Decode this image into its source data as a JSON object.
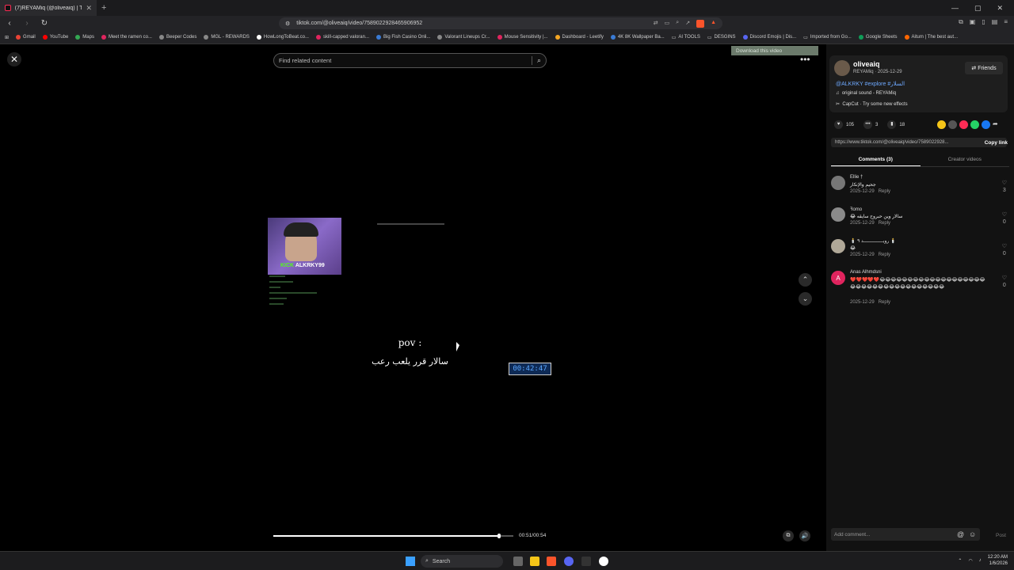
{
  "browser": {
    "tab_title": "(7)REYAMiq (@oliveaiq) | TikTok",
    "url": "tiktok.com/@oliveaiq/video/7589022928465906952",
    "bookmarks": [
      "Gmail",
      "YouTube",
      "Maps",
      "Meet the ramen co...",
      "Beeper Codes",
      "MGL - REWARDS",
      "HowLongToBeat.co...",
      "skill-capped valoran...",
      "Big Fish Casino Onli...",
      "Valorant Lineups Cr...",
      "Mouse Sensitivity |...",
      "Dashboard - Leetify",
      "4K 8K Wallpaper Ba...",
      "AI TOOLS",
      "DESGINS",
      "Discord Emojis | Dis...",
      "Imported from Go...",
      "Google Sheets",
      "Aitum | The best aut..."
    ]
  },
  "video": {
    "search_placeholder": "Find related content",
    "webcam_label_kick": "KICK",
    "webcam_label_user": "ALKRKY99",
    "pov_text": "pov :",
    "caption": "سالار قرر يلعب رعب",
    "timer": "00:42:47",
    "time_label": "00:51/00:54",
    "progress": 0.94,
    "download_label": "Download this video"
  },
  "author": {
    "name": "oliveaiq",
    "meta": "REYAMiq · 2025-12-29",
    "friends_label": "Friends",
    "description": "@ALKRKY #explore #السلار",
    "sound": "original sound - REYAMiq",
    "capcut": "CapCut · Try some new effects"
  },
  "stats": {
    "likes": "105",
    "comments": "3",
    "saves": "18"
  },
  "share_colors": [
    "#f5c518",
    "#555555",
    "#fe2c55",
    "#25d366",
    "#1877f2"
  ],
  "link": {
    "url": "https://www.tiktok.com/@oliveaiq/video/7589022928...",
    "copy_label": "Copy link"
  },
  "tabs": {
    "comments": "Comments (3)",
    "creator_videos": "Creator videos"
  },
  "comments": [
    {
      "user": "Ellie †",
      "text": "جحيم والإنكار",
      "date": "2025-12-29",
      "reply": "Reply",
      "likes": "3",
      "avatar": "",
      "color": "#777777"
    },
    {
      "user": "ꟻomo",
      "text": "😂 سالار وين حبروح سايقه",
      "date": "2025-12-29",
      "reply": "Reply",
      "likes": "0",
      "avatar": "",
      "color": "#8a8a8a"
    },
    {
      "user": "🕯️ رويــــــــــــــد ٩ 🕯️",
      "text": "😂",
      "date": "2025-12-29",
      "reply": "Reply",
      "likes": "0",
      "avatar": "",
      "color": "#b0a898"
    },
    {
      "user": "Anas Alhmdsni",
      "text": "❤️❤️❤️❤️❤️😂😂😂😂😂😂😂😂😂😂😂😂😂😂😂😂😂😂😂😂😂😂😂😂😂😂😂😂😂😂😂😂😂😂😂😂",
      "date": "2025-12-29",
      "reply": "Reply",
      "likes": "0",
      "avatar": "A",
      "color": "#e0245e"
    }
  ],
  "add_comment": {
    "placeholder": "Add comment...",
    "post_label": "Post"
  },
  "taskbar": {
    "search_label": "Search",
    "time": "12:20 AM",
    "date": "1/6/2026"
  }
}
